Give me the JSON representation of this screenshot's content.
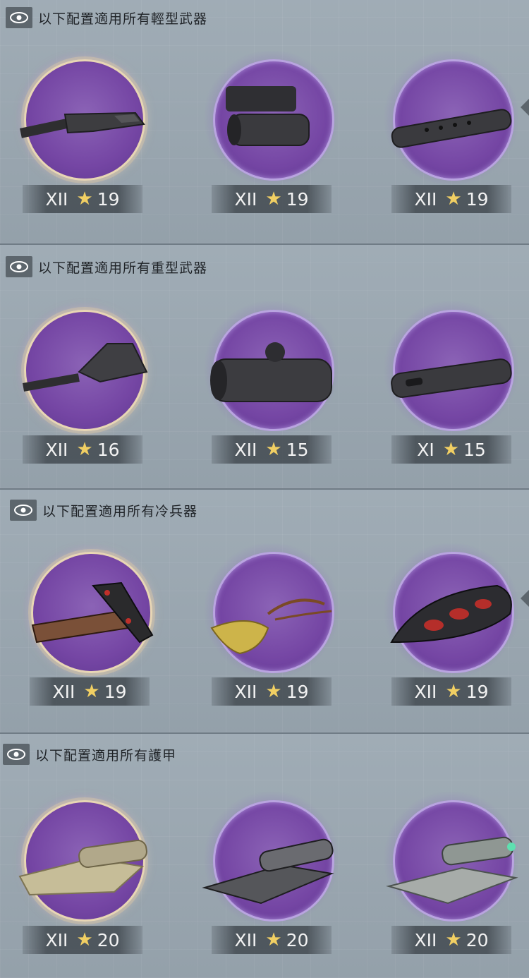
{
  "sections": [
    {
      "title": "以下配置適用所有輕型武器",
      "items": [
        {
          "icon": "rifle-stock-icon",
          "tier": "XII",
          "level": "19",
          "equipped": true
        },
        {
          "icon": "scope-icon",
          "tier": "XII",
          "level": "19"
        },
        {
          "icon": "barrel-icon",
          "tier": "XII",
          "level": "19"
        }
      ]
    },
    {
      "title": "以下配置適用所有重型武器",
      "items": [
        {
          "icon": "heavy-stock-icon",
          "tier": "XII",
          "level": "16",
          "equipped": true
        },
        {
          "icon": "heavy-scope-icon",
          "tier": "XII",
          "level": "15"
        },
        {
          "icon": "heavy-barrel-icon",
          "tier": "XI",
          "level": "15"
        }
      ]
    },
    {
      "title": "以下配置適用所有冷兵器",
      "items": [
        {
          "icon": "blade-hilt-icon",
          "tier": "XII",
          "level": "19",
          "equipped": true
        },
        {
          "icon": "tassel-icon",
          "tier": "XII",
          "level": "19"
        },
        {
          "icon": "ornament-icon",
          "tier": "XII",
          "level": "19"
        }
      ]
    },
    {
      "title": "以下配置適用所有護甲",
      "items": [
        {
          "icon": "cloth-roll-icon",
          "tier": "XII",
          "level": "20",
          "equipped": true
        },
        {
          "icon": "chainmail-roll-icon",
          "tier": "XII",
          "level": "20"
        },
        {
          "icon": "hex-plate-roll-icon",
          "tier": "XII",
          "level": "20"
        }
      ]
    }
  ],
  "colors": {
    "accent_purple": "#7546a4",
    "star": "#f1cf63",
    "label_bg": "#373e44"
  }
}
